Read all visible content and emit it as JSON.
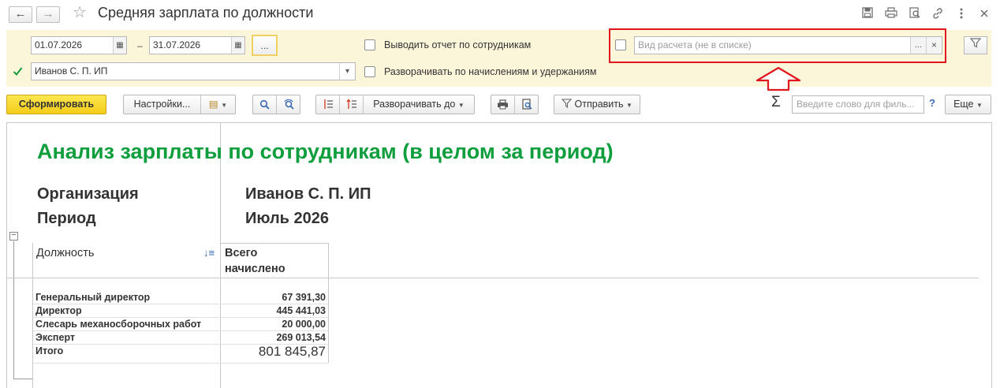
{
  "window": {
    "title": "Средняя зарплата по должности",
    "back_icon": "arrow-left-icon",
    "forward_icon": "arrow-right-icon",
    "favorite_glyph": "☆",
    "toolbar_icons": [
      "save-icon",
      "print-icon",
      "preview-icon",
      "link-icon",
      "more-vert-icon",
      "close-icon"
    ]
  },
  "filters": {
    "date_from": "01.07.2026",
    "date_separator": "–",
    "date_to": "31.07.2026",
    "period_button": "...",
    "organization": "Иванов С. П. ИП",
    "organization_checked": true,
    "show_by_employees_label": "Выводить отчет по сотрудникам",
    "expand_accruals_label": "Разворачивать по начислениям и удержаниям",
    "calc_kind_placeholder": "Вид расчета (не в списке)",
    "calc_kind_select": "...",
    "calc_kind_clear": "×"
  },
  "toolbar": {
    "generate_label": "Сформировать",
    "settings_label": "Настройки...",
    "expand_to_label": "Разворачивать до",
    "send_label": "Отправить",
    "sigma": "Σ",
    "search_placeholder": "Введите слово для филь...",
    "help_label": "?",
    "more_label": "Еще"
  },
  "report": {
    "title": "Анализ зарплаты по сотрудникам (в целом за период)",
    "organization_label": "Организация",
    "organization_value": "Иванов С. П. ИП",
    "period_label": "Период",
    "period_value": "Июль 2026",
    "col_position": "Должность",
    "col_total_line1": "Всего",
    "col_total_line2": "начислено",
    "rows": [
      {
        "name": "Генеральный директор",
        "value": "67 391,30"
      },
      {
        "name": "Директор",
        "value": "445 441,03"
      },
      {
        "name": "Слесарь механосборочных работ",
        "value": "20 000,00"
      },
      {
        "name": "Эксперт",
        "value": "269 013,54"
      }
    ],
    "total_label": "Итого",
    "total_value": "801 845,87"
  },
  "colors": {
    "accent_green": "#0f9e3d",
    "highlight_red": "#e0161e",
    "filter_bg": "#fbf6da",
    "primary_button": "#f3cc18"
  }
}
